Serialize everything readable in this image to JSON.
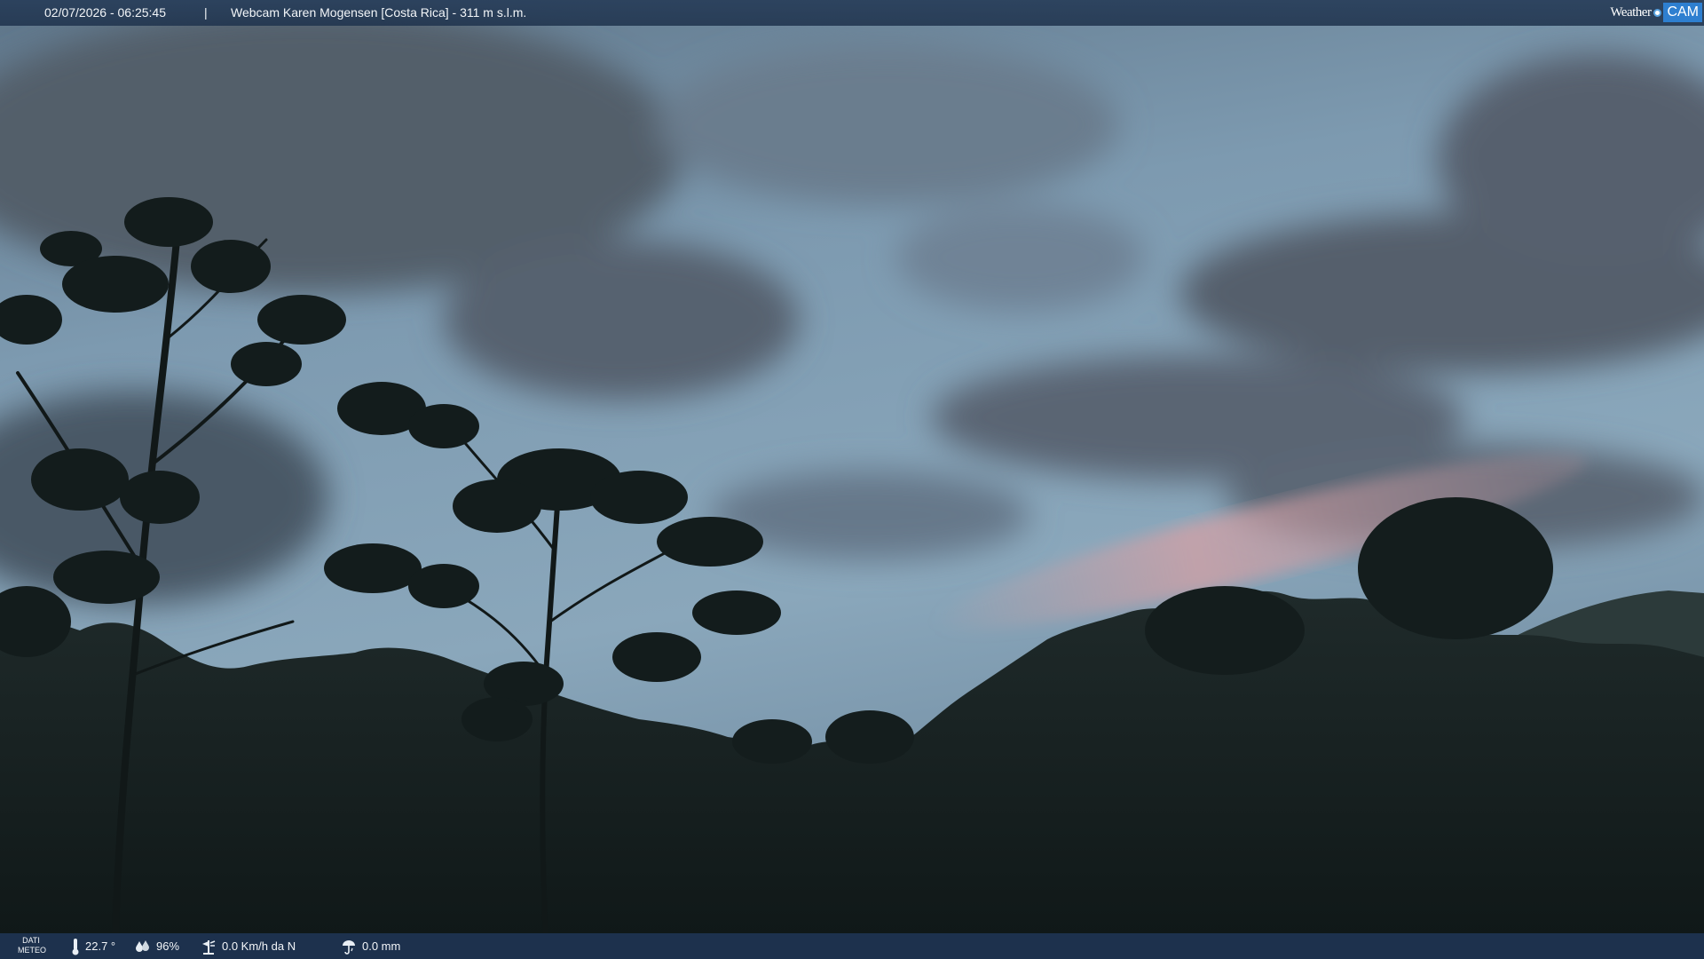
{
  "header": {
    "timestamp": "02/07/2026 - 06:25:45",
    "separator": "|",
    "title": "Webcam Karen Mogensen [Costa Rica]  - 311 m s.l.m."
  },
  "logo": {
    "weather": "Weather",
    "cam": "CAM"
  },
  "footer": {
    "meteo_label_line1": "DATI",
    "meteo_label_line2": "METEO",
    "temperature": "22.7 °",
    "humidity": "96%",
    "wind": "0.0 Km/h da N",
    "rain": "0.0 mm"
  },
  "icons": {
    "temperature": "thermometer-icon",
    "humidity": "humidity-icon",
    "wind": "wind-icon",
    "rain": "rain-icon"
  },
  "colors": {
    "bar_background": "#20344e",
    "logo_accent": "#2e7fd0"
  }
}
